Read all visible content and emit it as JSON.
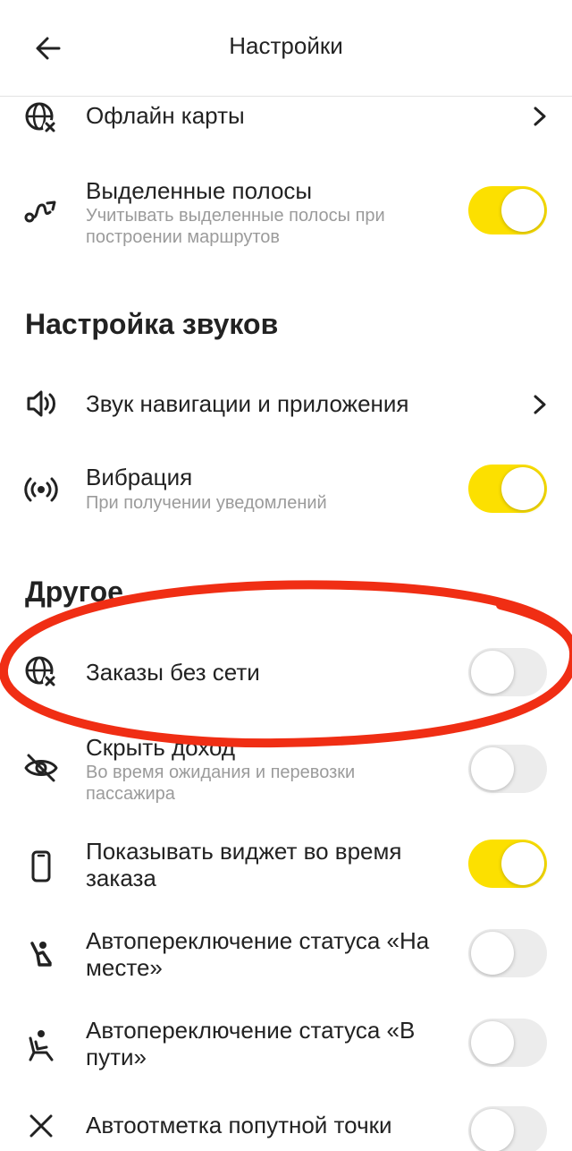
{
  "header": {
    "title": "Настройки",
    "back_icon": "arrow-left-icon"
  },
  "rows_top": {
    "offline_maps": {
      "title": "Офлайн карты",
      "icon": "globe-cross-icon"
    },
    "dedicated_lanes": {
      "title": "Выделенные полосы",
      "subtitle": "Учитывать выделенные полосы при построении маршрутов",
      "enabled": true,
      "icon": "route-icon"
    }
  },
  "sections": {
    "sound": {
      "title": "Настройка звуков",
      "nav_sound": {
        "title": "Звук навигации и приложения",
        "icon": "speaker-icon"
      },
      "vibration": {
        "title": "Вибрация",
        "subtitle": "При получении уведомлений",
        "enabled": true,
        "icon": "vibration-icon"
      }
    },
    "other": {
      "title": "Другое",
      "offline_orders": {
        "title": "Заказы без сети",
        "enabled": false,
        "icon": "globe-cross-icon"
      },
      "hide_income": {
        "title": "Скрыть доход",
        "subtitle": "Во время ожидания и перевозки пассажира",
        "enabled": false,
        "icon": "eye-off-icon"
      },
      "show_widget": {
        "title": "Показывать виджет во время заказа",
        "enabled": true,
        "icon": "phone-icon"
      },
      "auto_on_place": {
        "title": "Автопереключение статуса «На месте»",
        "enabled": false,
        "icon": "passenger-wave-icon"
      },
      "auto_on_way": {
        "title": "Автопереключение статуса «В пути»",
        "enabled": false,
        "icon": "passenger-seat-icon"
      },
      "auto_waypoint": {
        "title": "Автоотметка попутной точки",
        "enabled": false,
        "icon": "close-icon"
      }
    }
  },
  "colors": {
    "toggle_on": "#fce000",
    "annotation": "#f02e14"
  }
}
